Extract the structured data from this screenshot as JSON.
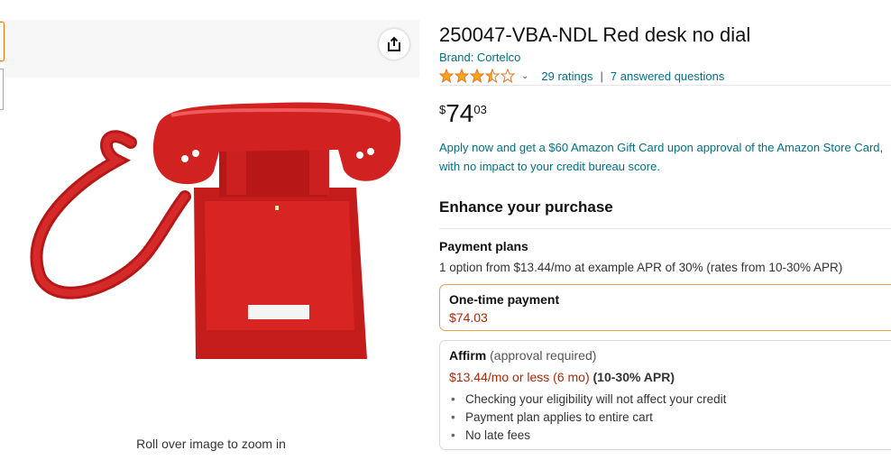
{
  "product": {
    "title": "250047-VBA-NDL Red desk no dial",
    "brand": "Brand: Cortelco",
    "rating_value": 3.5,
    "ratings_count": "29 ratings",
    "separator": "|",
    "answered_questions": "7 answered questions",
    "price": {
      "symbol": "$",
      "whole": "74",
      "fraction": "03"
    }
  },
  "image": {
    "caption": "Roll over image to zoom in",
    "phone_color": "#c81e1e"
  },
  "gift_card_promo": "Apply now and get a $60 Amazon Gift Card upon approval of the Amazon Store Card, with no impact to your credit bureau score.",
  "enhance": {
    "heading": "Enhance your purchase",
    "payment_plans_heading": "Payment plans",
    "payment_plans_desc": "1 option from $13.44/mo at example APR of 30% (rates from 10-30% APR)",
    "one_time": {
      "label": "One-time payment",
      "price": "$74.03"
    },
    "affirm": {
      "name": "Affirm",
      "note": " (approval required)",
      "price": "$13.44/mo or less (6 mo)",
      "apr": " (10-30% APR)",
      "bullets": [
        "Checking your eligibility will not affect your credit",
        "Payment plan applies to entire cart",
        "No late fees"
      ]
    }
  },
  "colors": {
    "link": "#007185",
    "price_red": "#B12704",
    "star": "#FFA41C",
    "selected_border": "#e6a34d"
  },
  "icons": [
    "share-icon",
    "star-icon",
    "chevron-down-icon"
  ]
}
